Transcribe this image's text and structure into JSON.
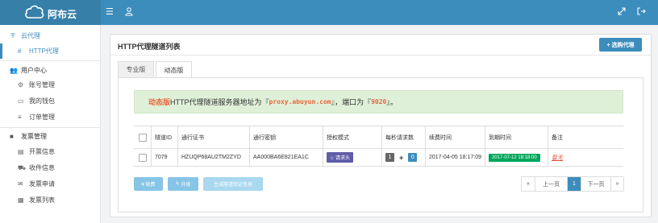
{
  "app": {
    "logo_text": "阿布云"
  },
  "topbar": {
    "menu_icon": "menu-icon",
    "user_icon": "user-icon",
    "fullscreen_icon": "expand-icon",
    "logout_icon": "logout-icon"
  },
  "sidebar": {
    "groups": [
      {
        "label": "云代理",
        "icon": "sliders-icon",
        "items": [
          {
            "label": "HTTP代理",
            "icon": "hash-icon"
          }
        ]
      },
      {
        "label": "用户中心",
        "icon": "users-icon",
        "items": [
          {
            "label": "账号管理",
            "icon": "gear-icon"
          },
          {
            "label": "我的钱包",
            "icon": "folder-icon"
          },
          {
            "label": "订单管理",
            "icon": "list-icon"
          }
        ]
      },
      {
        "label": "发票管理",
        "icon": "folder-icon",
        "items": [
          {
            "label": "开票信息",
            "icon": "document-icon"
          },
          {
            "label": "收件信息",
            "icon": "truck-icon"
          },
          {
            "label": "发票申请",
            "icon": "envelope-icon"
          },
          {
            "label": "发票列表",
            "icon": "table-icon"
          }
        ]
      }
    ]
  },
  "panel": {
    "title": "HTTP代理隧道列表",
    "buy_button": "+ 选购代理",
    "tabs": [
      {
        "label": "专业版"
      },
      {
        "label": "动态版"
      }
    ],
    "notice": {
      "badge": "动态版",
      "text_before": "HTTP代理隧道服务器地址为『",
      "host": "proxy.abuyun.com",
      "text_mid": "』，端口为『",
      "port": "9020",
      "text_after": "』。"
    },
    "table": {
      "headers": [
        "隧道ID",
        "通行证书",
        "通行密钥",
        "授权模式",
        "每秒请求数",
        "续费时间",
        "到期时间",
        "备注"
      ],
      "rows": [
        {
          "tunnel_id": "7079",
          "license": "HZUQP68AU2TM2ZYD",
          "secret": "AA000BA6E821EA1C",
          "auth_mode": "☆ 请求头",
          "rps": "1",
          "rps_add": "0",
          "renew_time": "2017-04-05 18:17:09",
          "expire_time": "2017-07-12 18:18:00",
          "remark": "暂无"
        }
      ]
    },
    "actions": {
      "renew": "¥ 续费",
      "upgrade": "升级",
      "gen_auth": "生成隧道验证信息"
    },
    "pagination": {
      "prev": "上一页",
      "current": "1",
      "next": "下一页",
      "first_arrow": "«",
      "last_arrow": "»"
    }
  }
}
